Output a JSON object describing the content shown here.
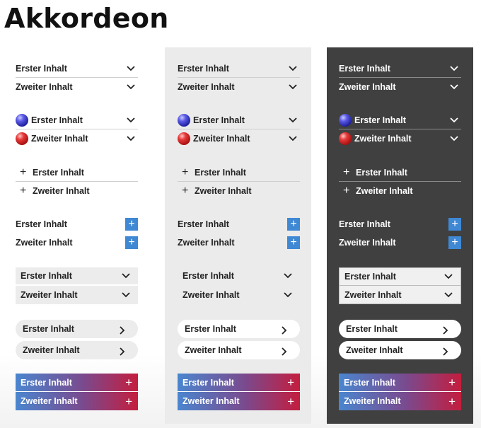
{
  "page": {
    "title": "Akkordeon"
  },
  "items": {
    "first": "Erster Inhalt",
    "second": "Zweiter Inhalt"
  },
  "colors": {
    "accent_blue": "#3f88d4",
    "dark_panel": "#404040",
    "light_panel": "#ebebeb",
    "gradient_start": "#4a86cf",
    "gradient_end": "#c41d3e"
  },
  "icons": {
    "chevron": "chevron-down-icon",
    "chevron_right": "chevron-right-icon",
    "plus": "plus-icon",
    "ball_blue": "blue-ball-icon",
    "ball_red": "red-ball-icon"
  },
  "columns": [
    {
      "theme": "white"
    },
    {
      "theme": "light-gray"
    },
    {
      "theme": "dark"
    }
  ]
}
